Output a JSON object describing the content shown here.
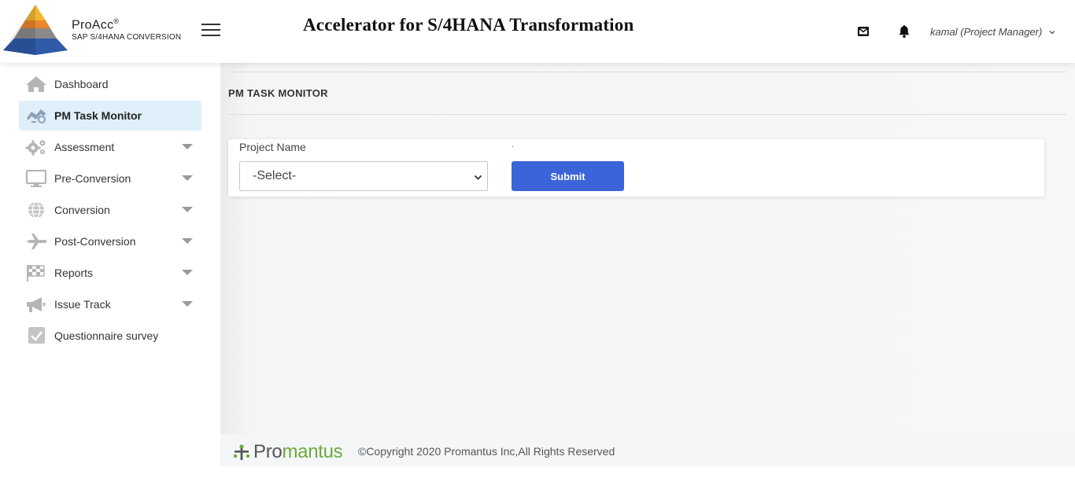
{
  "header": {
    "brand_name": "ProAcc",
    "brand_mark": "®",
    "brand_subtitle": "SAP S/4HANA CONVERSION",
    "app_title": "Accelerator for S/4HANA Transformation",
    "user_label": "kamal (Project Manager)",
    "icons": [
      "menu-icon",
      "mail-icon",
      "bell-icon",
      "chevron-down-icon"
    ]
  },
  "sidebar": {
    "items": [
      {
        "label": "Dashboard",
        "icon": "home-icon",
        "has_submenu": false,
        "active": false
      },
      {
        "label": "PM Task Monitor",
        "icon": "monitor-task-icon",
        "has_submenu": false,
        "active": true
      },
      {
        "label": "Assessment",
        "icon": "gears-icon",
        "has_submenu": true,
        "active": false
      },
      {
        "label": "Pre-Conversion",
        "icon": "desktop-icon",
        "has_submenu": true,
        "active": false
      },
      {
        "label": "Conversion",
        "icon": "globe-icon",
        "has_submenu": true,
        "active": false
      },
      {
        "label": "Post-Conversion",
        "icon": "plane-icon",
        "has_submenu": true,
        "active": false
      },
      {
        "label": "Reports",
        "icon": "checkered-flag-icon",
        "has_submenu": true,
        "active": false
      },
      {
        "label": "Issue Track",
        "icon": "megaphone-icon",
        "has_submenu": true,
        "active": false
      },
      {
        "label": "Questionnaire survey",
        "icon": "checkbox-icon",
        "has_submenu": false,
        "active": false
      }
    ]
  },
  "main": {
    "page_title": "PM TASK MONITOR",
    "form": {
      "project_label": "Project Name",
      "second_label": ".",
      "project_select_value": "-Select-",
      "submit_label": "Submit"
    }
  },
  "footer": {
    "logo_text_a": "Pro",
    "logo_text_b": "mantus",
    "copyright": "©Copyright 2020 Promantus Inc,All Rights Reserved"
  },
  "colors": {
    "accent_button": "#3b64d8",
    "active_nav_bg": "#dff0fb",
    "footer_logo_green": "#6aab3c"
  }
}
